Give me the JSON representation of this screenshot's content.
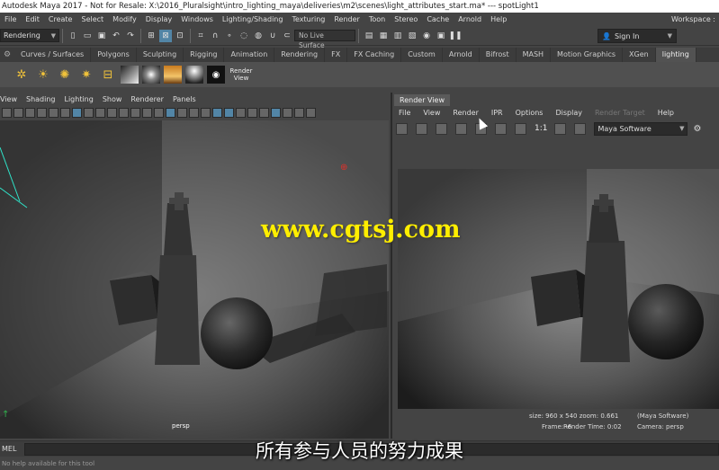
{
  "app": {
    "title": "Autodesk Maya 2017 - Not for Resale: X:\\2016_Pluralsight\\intro_lighting_maya\\deliveries\\m2\\scenes\\light_attributes_start.ma*   ---   spotLight1",
    "workspace_label": "Workspace :"
  },
  "menubar": {
    "items": [
      "File",
      "Edit",
      "Create",
      "Select",
      "Modify",
      "Display",
      "Windows",
      "Lighting/Shading",
      "Texturing",
      "Render",
      "Toon",
      "Stereo",
      "Cache",
      "Arnold",
      "Help"
    ]
  },
  "statusline": {
    "mode": "Rendering",
    "live_surface": "No Live Surface",
    "sign_in": "Sign In"
  },
  "shelf": {
    "tabs": [
      "Curves / Surfaces",
      "Polygons",
      "Sculpting",
      "Rigging",
      "Animation",
      "Rendering",
      "FX",
      "FX Caching",
      "Custom",
      "Arnold",
      "Bifrost",
      "MASH",
      "Motion Graphics",
      "XGen",
      "lighting"
    ],
    "active_tab": "lighting",
    "render_view_label": "Render View"
  },
  "viewport": {
    "menu": [
      "View",
      "Shading",
      "Lighting",
      "Show",
      "Renderer",
      "Panels"
    ],
    "camera_label": "persp"
  },
  "render_view": {
    "tab_label": "Render View",
    "menu": [
      "File",
      "View",
      "Render",
      "IPR",
      "Options",
      "Display",
      "Render Target",
      "Help"
    ],
    "ratio": "1:1",
    "renderer": "Maya Software",
    "info": {
      "size": "size: 960 x 540  zoom: 0.661",
      "renderer": "(Maya Software)",
      "frame": "Frame: -6",
      "render_time": "Render Time: 0:02",
      "camera": "Camera: persp"
    }
  },
  "command_line": {
    "language": "MEL"
  },
  "help_line": {
    "text": "No help available for this tool"
  },
  "overlay": {
    "subtitle": "所有参与人员的努力成果",
    "watermark": "www.cgtsj.com"
  }
}
